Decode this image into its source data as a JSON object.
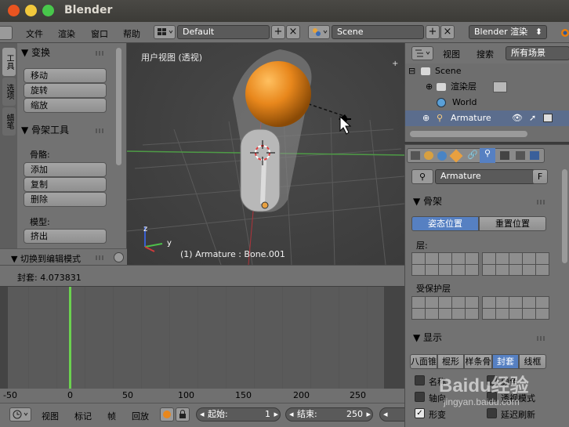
{
  "window": {
    "title": "Blender",
    "btn_colors": [
      "#e95420",
      "#f2c83c",
      "#48c74b"
    ]
  },
  "menubar": {
    "items": [
      "文件",
      "渲染",
      "窗口",
      "帮助"
    ],
    "layout": "Default",
    "scene": "Scene",
    "engine": "Blender 渲染"
  },
  "toolshelf": {
    "tabs": [
      "工具",
      "选项",
      "蜡笔"
    ],
    "transform_title": "▼ 变换",
    "transform_buttons": [
      "移动",
      "旋转",
      "缩放"
    ],
    "armature_title": "▼ 骨架工具",
    "bones_label": "骨骼:",
    "bones_buttons": [
      "添加",
      "复制",
      "删除"
    ],
    "model_label": "模型:",
    "model_buttons": [
      "挤出"
    ],
    "editmode": "▼ 切换到编辑模式"
  },
  "viewport": {
    "title": "用户视图 (透视)",
    "status": "(1) Armature : Bone.001",
    "axis_labels": {
      "z": "z",
      "y": "y"
    }
  },
  "statusbar": {
    "text": "封套: 4.073831"
  },
  "timeline": {
    "ruler": [
      "-50",
      "0",
      "50",
      "100",
      "150",
      "200",
      "250"
    ],
    "current_frame_marker": 0,
    "header": {
      "menus": [
        "视图",
        "标记",
        "帧",
        "回放"
      ],
      "start_label": "起始:",
      "start_value": "1",
      "end_label": "结束:",
      "end_value": "250"
    }
  },
  "outliner": {
    "header": {
      "view": "视图",
      "search": "搜索",
      "filter": "所有场景"
    },
    "rows": [
      {
        "label": "Scene"
      },
      {
        "label": "渲染层"
      },
      {
        "label": "World"
      },
      {
        "label": "Armature"
      }
    ]
  },
  "properties": {
    "object_name": "Armature",
    "fake_user": "F",
    "armature_panel": "▼ 骨架",
    "pose_position": "姿态位置",
    "rest_position": "重置位置",
    "layers_label": "层:",
    "protected_label": "受保护层",
    "display_panel": "▼ 显示",
    "display_modes": [
      "八面锥",
      "棍形",
      "样条骨",
      "封套",
      "线框"
    ],
    "checks": {
      "name": "名称",
      "color": "颜色",
      "axes": "轴向",
      "xray": "透视模式",
      "shape": "形变",
      "delay": "延迟刷新"
    }
  },
  "watermark": {
    "brand": "Baidu经验",
    "url": "jingyan.baidu.com"
  },
  "colors": {
    "accent": "#5680c2",
    "selected_row": "#5b6d8d",
    "timeline_cursor": "#6bd24f",
    "sphere": "#e8871c"
  }
}
